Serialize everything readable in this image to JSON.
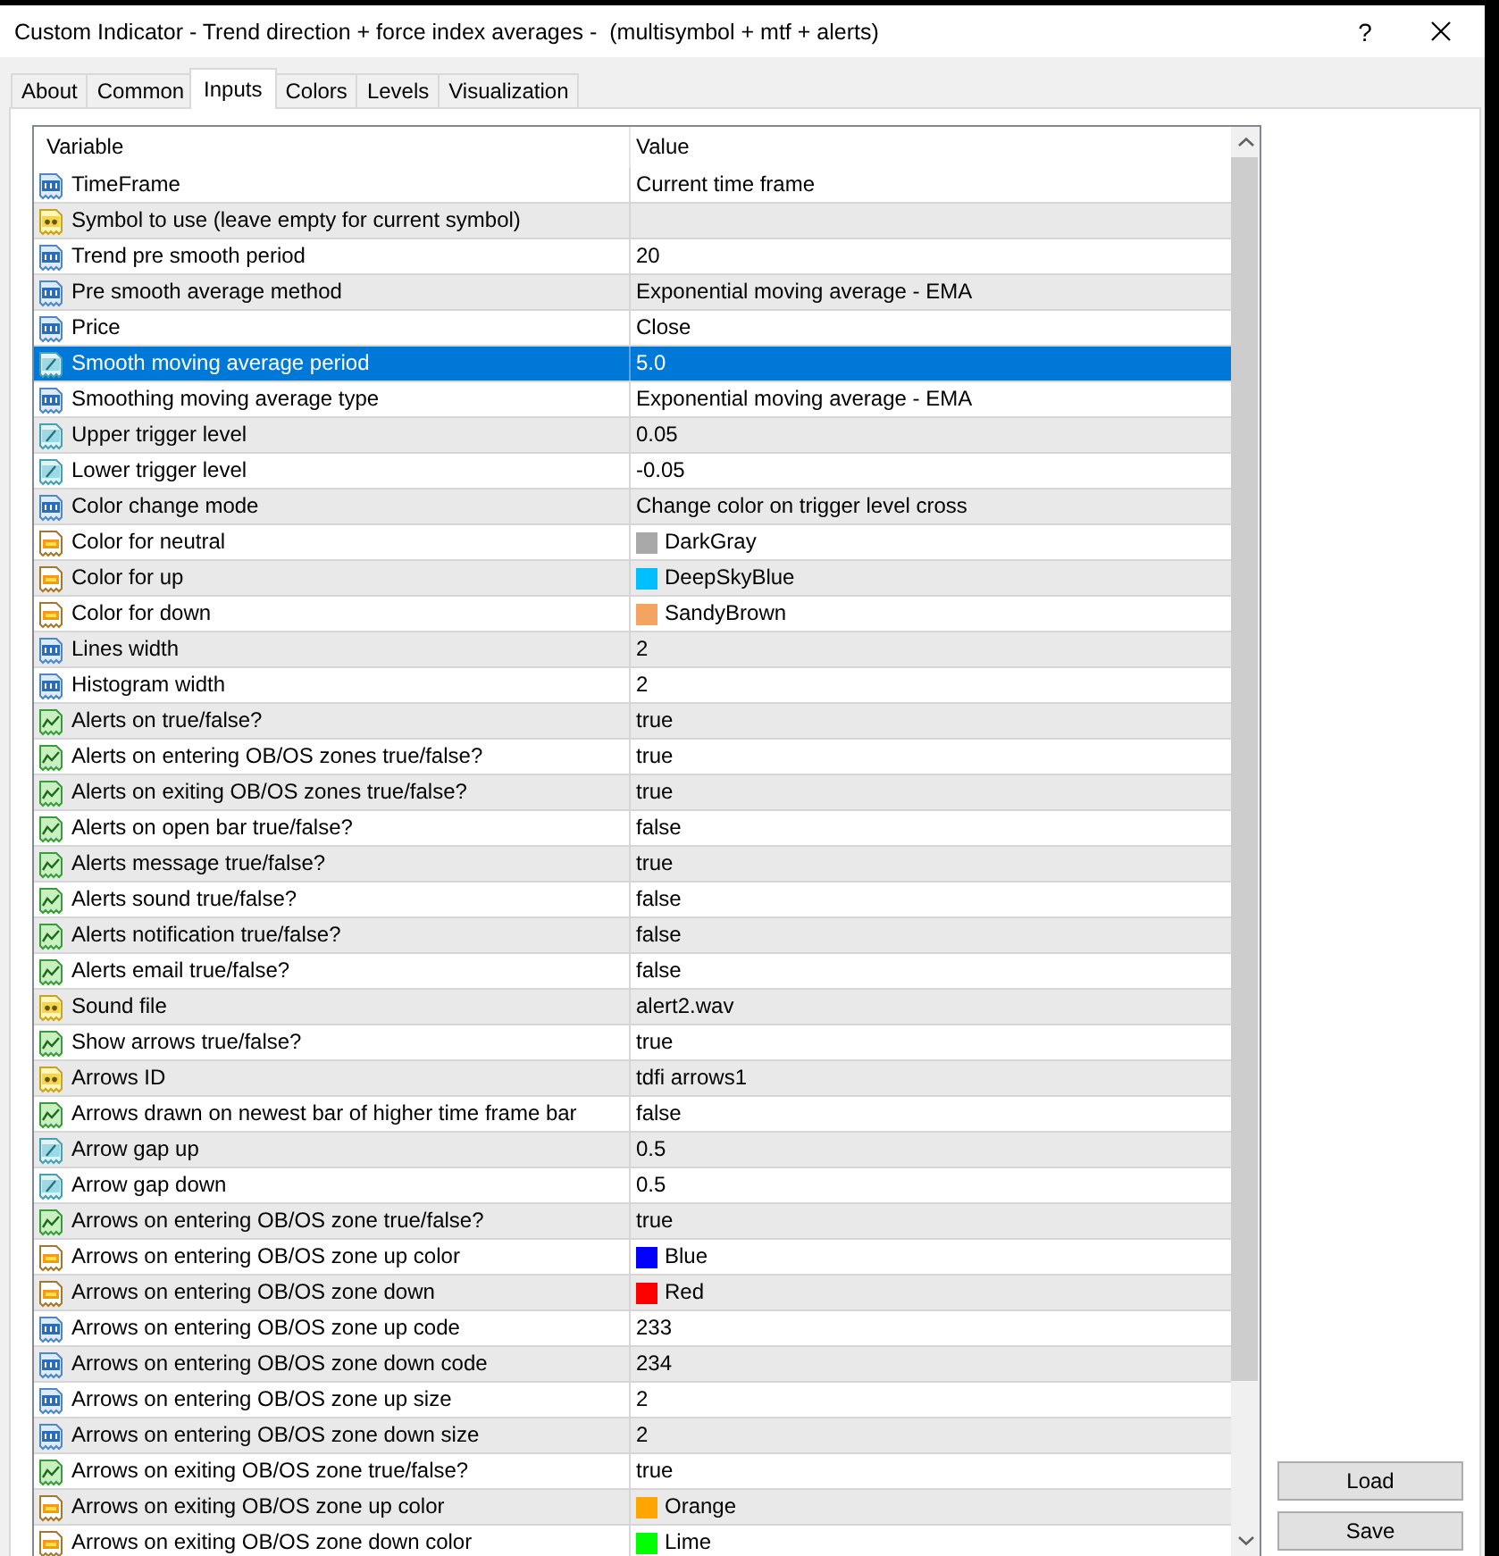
{
  "window": {
    "title": "Custom Indicator - Trend direction + force index averages -  (multisymbol + mtf + alerts)",
    "help_label": "?"
  },
  "tabs": [
    {
      "label": "About",
      "selected": false
    },
    {
      "label": "Common",
      "selected": false
    },
    {
      "label": "Inputs",
      "selected": true
    },
    {
      "label": "Colors",
      "selected": false
    },
    {
      "label": "Levels",
      "selected": false
    },
    {
      "label": "Visualization",
      "selected": false
    }
  ],
  "table": {
    "columns": [
      "Variable",
      "Value"
    ],
    "rows": [
      {
        "kind": "int",
        "variable": "TimeFrame",
        "value": "Current time frame",
        "selected": false
      },
      {
        "kind": "string",
        "variable": "Symbol to use (leave empty for current symbol)",
        "selected": false
      },
      {
        "kind": "int",
        "variable": "Trend pre smooth period",
        "value": "20",
        "selected": false
      },
      {
        "kind": "int",
        "variable": "Pre smooth average method",
        "value": "Exponential moving average - EMA",
        "selected": false
      },
      {
        "kind": "int",
        "variable": "Price",
        "value": "Close",
        "selected": false
      },
      {
        "kind": "double",
        "variable": "Smooth moving average period",
        "value": "5.0",
        "selected": true
      },
      {
        "kind": "int",
        "variable": "Smoothing moving average type",
        "value": "Exponential moving average - EMA",
        "selected": false
      },
      {
        "kind": "double",
        "variable": "Upper trigger level",
        "value": "0.05",
        "selected": false
      },
      {
        "kind": "double",
        "variable": "Lower trigger level",
        "value": "-0.05",
        "selected": false
      },
      {
        "kind": "int",
        "variable": "Color change mode",
        "value": "Change color on trigger level cross",
        "selected": false
      },
      {
        "kind": "color",
        "variable": "Color for neutral",
        "value": "DarkGray",
        "color": "#a9a9a9",
        "selected": false
      },
      {
        "kind": "color",
        "variable": "Color for up",
        "value": "DeepSkyBlue",
        "color": "#00bfff",
        "selected": false
      },
      {
        "kind": "color",
        "variable": "Color for down",
        "value": "SandyBrown",
        "color": "#f4a460",
        "selected": false
      },
      {
        "kind": "int",
        "variable": "Lines width",
        "value": "2",
        "selected": false
      },
      {
        "kind": "int",
        "variable": "Histogram width",
        "value": "2",
        "selected": false
      },
      {
        "kind": "bool",
        "variable": "Alerts on true/false?",
        "value": "true",
        "selected": false
      },
      {
        "kind": "bool",
        "variable": "Alerts on entering OB/OS zones true/false?",
        "value": "true",
        "selected": false
      },
      {
        "kind": "bool",
        "variable": "Alerts on exiting OB/OS zones true/false?",
        "value": "true",
        "selected": false
      },
      {
        "kind": "bool",
        "variable": "Alerts on open bar true/false?",
        "value": "false",
        "selected": false
      },
      {
        "kind": "bool",
        "variable": "Alerts message true/false?",
        "value": "true",
        "selected": false
      },
      {
        "kind": "bool",
        "variable": "Alerts sound true/false?",
        "value": "false",
        "selected": false
      },
      {
        "kind": "bool",
        "variable": "Alerts notification true/false?",
        "value": "false",
        "selected": false
      },
      {
        "kind": "bool",
        "variable": "Alerts email true/false?",
        "value": "false",
        "selected": false
      },
      {
        "kind": "string",
        "variable": "Sound file",
        "value": "alert2.wav",
        "selected": false
      },
      {
        "kind": "bool",
        "variable": "Show arrows true/false?",
        "value": "true",
        "selected": false
      },
      {
        "kind": "string",
        "variable": "Arrows ID",
        "value": "tdfi arrows1",
        "selected": false
      },
      {
        "kind": "bool",
        "variable": "Arrows drawn on newest bar of higher time frame bar",
        "value": "false",
        "selected": false
      },
      {
        "kind": "double",
        "variable": "Arrow gap up",
        "value": "0.5",
        "selected": false
      },
      {
        "kind": "double",
        "variable": "Arrow gap down",
        "value": "0.5",
        "selected": false
      },
      {
        "kind": "bool",
        "variable": "Arrows on entering OB/OS zone true/false?",
        "value": "true",
        "selected": false
      },
      {
        "kind": "color",
        "variable": "Arrows on entering OB/OS zone up color",
        "value": "Blue",
        "color": "#0000ff",
        "selected": false
      },
      {
        "kind": "color",
        "variable": "Arrows on entering OB/OS zone down",
        "value": "Red",
        "color": "#ff0000",
        "selected": false
      },
      {
        "kind": "int",
        "variable": "Arrows on entering OB/OS zone up code",
        "value": "233",
        "selected": false
      },
      {
        "kind": "int",
        "variable": "Arrows on entering OB/OS zone down code",
        "value": "234",
        "selected": false
      },
      {
        "kind": "int",
        "variable": "Arrows on entering OB/OS zone up size",
        "value": "2",
        "selected": false
      },
      {
        "kind": "int",
        "variable": "Arrows on entering OB/OS zone down size",
        "value": "2",
        "selected": false
      },
      {
        "kind": "bool",
        "variable": "Arrows on exiting OB/OS zone true/false?",
        "value": "true",
        "selected": false
      },
      {
        "kind": "color",
        "variable": "Arrows on exiting OB/OS zone up color",
        "value": "Orange",
        "color": "#ffa500",
        "selected": false
      },
      {
        "kind": "color",
        "variable": "Arrows on exiting OB/OS zone down color",
        "value": "Lime",
        "color": "#00ff00",
        "selected": false
      }
    ]
  },
  "buttons": [
    "Load",
    "Save"
  ]
}
